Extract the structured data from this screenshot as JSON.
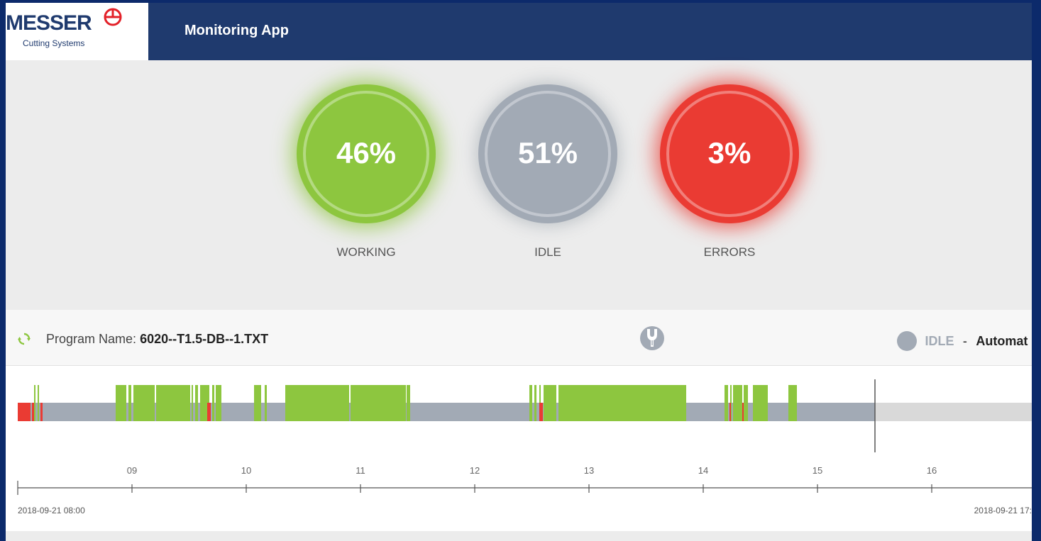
{
  "header": {
    "logo_text": "MESSER",
    "logo_subtitle": "Cutting Systems",
    "app_title": "Monitoring App"
  },
  "stats": [
    {
      "label": "WORKING",
      "value": "46%",
      "color": "#8dc63f"
    },
    {
      "label": "IDLE",
      "value": "51%",
      "color": "#a2aab5"
    },
    {
      "label": "ERRORS",
      "value": "3%",
      "color": "#ea3b33"
    }
  ],
  "program": {
    "label": "Program Name:",
    "name": "6020--T1.5-DB--1.TXT",
    "refresh_icon": "refresh-icon",
    "tool_icon": "torch-tool-icon"
  },
  "status": {
    "state": "IDLE",
    "separator": "-",
    "mode": "Automat"
  },
  "timeline": {
    "start_label": "2018-09-21 08:00",
    "end_label": "2018-09-21 17:",
    "hour_ticks": [
      "09",
      "10",
      "11",
      "12",
      "13",
      "14",
      "15",
      "16"
    ],
    "colors": {
      "working": "#8dc63f",
      "idle": "#a2aab5",
      "error": "#ea3b33",
      "future": "#d9d9d9"
    }
  }
}
